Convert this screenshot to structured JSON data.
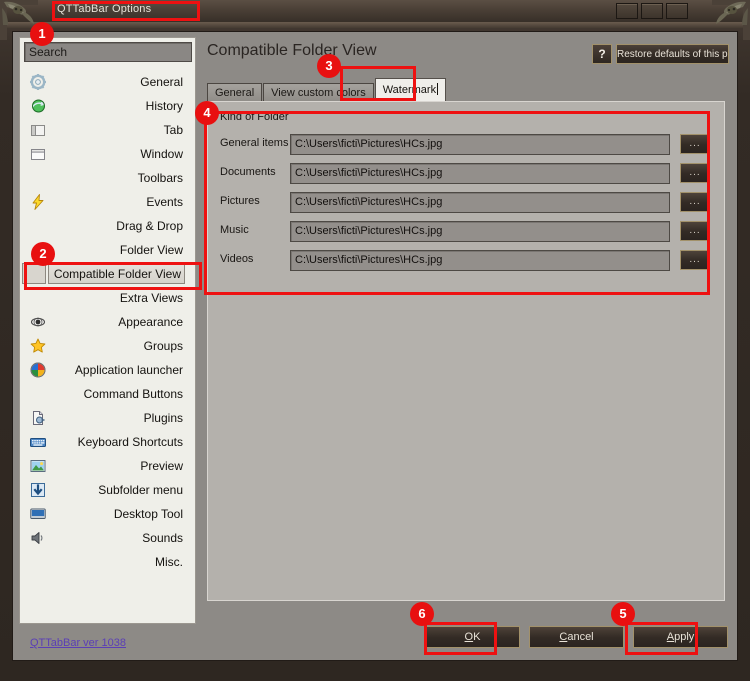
{
  "window": {
    "title": "QTTabBar Options",
    "controls": [
      "minimize",
      "maximize",
      "close"
    ]
  },
  "sidebar": {
    "search": {
      "value": "Search",
      "placeholder": "Search"
    },
    "items": [
      {
        "label": "General",
        "icon": "gear-icon",
        "selected": false
      },
      {
        "label": "History",
        "icon": "history-globe-icon",
        "selected": false
      },
      {
        "label": "Tab",
        "icon": "tab-icon",
        "selected": false
      },
      {
        "label": "Window",
        "icon": "window-icon",
        "selected": false
      },
      {
        "label": "Toolbars",
        "icon": "none",
        "selected": false
      },
      {
        "label": "Events",
        "icon": "lightning-icon",
        "selected": false
      },
      {
        "label": "Drag & Drop",
        "icon": "none",
        "selected": false
      },
      {
        "label": "Folder View",
        "icon": "none",
        "selected": false
      },
      {
        "label": "Compatible Folder View",
        "icon": "blank-icon",
        "selected": true
      },
      {
        "label": "Extra Views",
        "icon": "none",
        "selected": false
      },
      {
        "label": "Appearance",
        "icon": "eye-icon",
        "selected": false
      },
      {
        "label": "Groups",
        "icon": "star-icon",
        "selected": false
      },
      {
        "label": "Application launcher",
        "icon": "windows-orb-icon",
        "selected": false
      },
      {
        "label": "Command Buttons",
        "icon": "none",
        "selected": false
      },
      {
        "label": "Plugins",
        "icon": "plugin-page-icon",
        "selected": false
      },
      {
        "label": "Keyboard Shortcuts",
        "icon": "keyboard-icon",
        "selected": false
      },
      {
        "label": "Preview",
        "icon": "preview-image-icon",
        "selected": false
      },
      {
        "label": "Subfolder menu",
        "icon": "down-arrow-icon",
        "selected": false
      },
      {
        "label": "Desktop Tool",
        "icon": "desktop-monitor-icon",
        "selected": false
      },
      {
        "label": "Sounds",
        "icon": "speaker-icon",
        "selected": false
      },
      {
        "label": "Misc.",
        "icon": "none",
        "selected": false
      }
    ],
    "version_link": "QTTabBar ver 1038"
  },
  "main": {
    "page_title": "Compatible Folder View",
    "help_button": "?",
    "restore_defaults_button": "Restore defaults of this page",
    "tabs": [
      {
        "label": "General",
        "active": false
      },
      {
        "label": "View custom colors",
        "active": false
      },
      {
        "label": "Watermark",
        "active": true
      }
    ],
    "groupbox": {
      "title": "Kind of Folder",
      "browse_button": "...",
      "rows": [
        {
          "label": "General items",
          "value": "C:\\Users\\ficti\\Pictures\\HCs.jpg"
        },
        {
          "label": "Documents",
          "value": "C:\\Users\\ficti\\Pictures\\HCs.jpg"
        },
        {
          "label": "Pictures",
          "value": "C:\\Users\\ficti\\Pictures\\HCs.jpg"
        },
        {
          "label": "Music",
          "value": "C:\\Users\\ficti\\Pictures\\HCs.jpg"
        },
        {
          "label": "Videos",
          "value": "C:\\Users\\ficti\\Pictures\\HCs.jpg"
        }
      ]
    }
  },
  "footer": {
    "ok_button": "OK",
    "cancel_button": "Cancel",
    "apply_button": "Apply"
  },
  "annotations": {
    "markers": [
      "1",
      "2",
      "3",
      "4",
      "5",
      "6"
    ]
  },
  "colors": {
    "annotation_red": "#ee1111",
    "frame_dark": "#2e2721",
    "client_gray": "#8d8a86",
    "sidebar_bg": "#efefe9",
    "link_purple": "#5b3fb5"
  }
}
